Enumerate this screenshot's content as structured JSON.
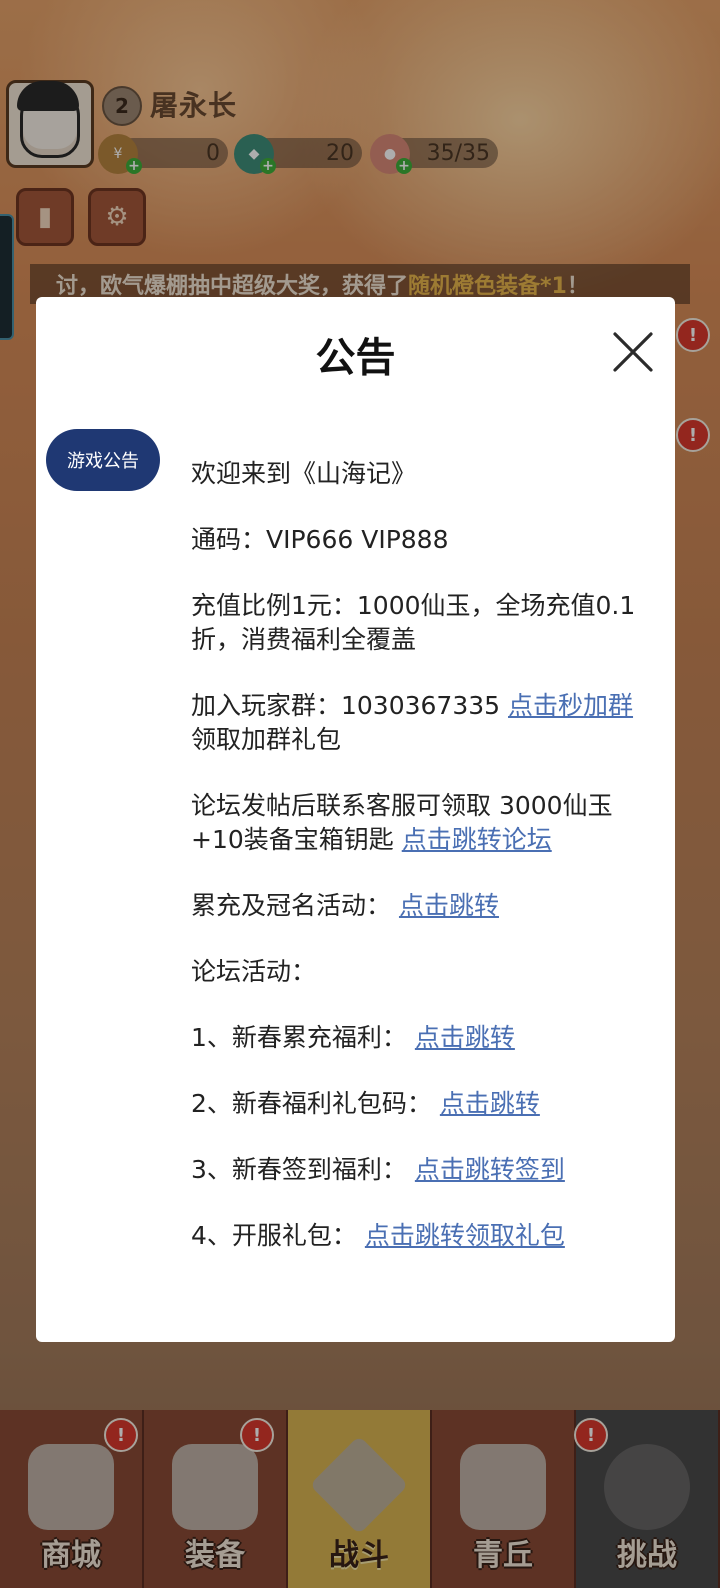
{
  "player": {
    "level": "2",
    "name": "屠永长",
    "resources": [
      {
        "name": "coin-icon",
        "value": "0"
      },
      {
        "name": "jade-icon",
        "value": "20"
      },
      {
        "name": "peach-icon",
        "value": "35/35"
      }
    ]
  },
  "marquee": {
    "text": "讨，欧气爆棚抽中超级大奖，获得了",
    "highlight": "随机橙色装备*1",
    "end": "！"
  },
  "modal": {
    "title": "公告",
    "tab_label": "游戏公告",
    "lines": {
      "welcome": "欢迎来到《山海记》",
      "code": "通码：VIP666 VIP888",
      "ratio": "充值比例1元：1000仙玉，全场充值0.1折，消费福利全覆盖",
      "group_text": "加入玩家群：1030367335 ",
      "group_link": "点击秒加群",
      "group_suffix": " 领取加群礼包",
      "forum_text": "论坛发帖后联系客服可领取 3000仙玉+10装备宝箱钥匙 ",
      "forum_link": "点击跳转论坛",
      "recharge_text": "累充及冠名活动： ",
      "recharge_link": "点击跳转",
      "activities_heading": "论坛活动：",
      "item1_text": "1、新春累充福利： ",
      "item1_link": "点击跳转",
      "item2_text": "2、新春福利礼包码： ",
      "item2_link": "点击跳转",
      "item3_text": "3、新春签到福利： ",
      "item3_link": "点击跳转签到",
      "item4_text": "4、开服礼包： ",
      "item4_link": "点击跳转领取礼包"
    }
  },
  "nav": {
    "tabs": [
      {
        "label": "商城"
      },
      {
        "label": "装备"
      },
      {
        "label": "战斗"
      },
      {
        "label": "青丘"
      },
      {
        "label": "挑战"
      }
    ]
  },
  "colors": {
    "modal_tab": "#1f3873",
    "link": "#4a6fb3",
    "alert": "#d9382d"
  }
}
